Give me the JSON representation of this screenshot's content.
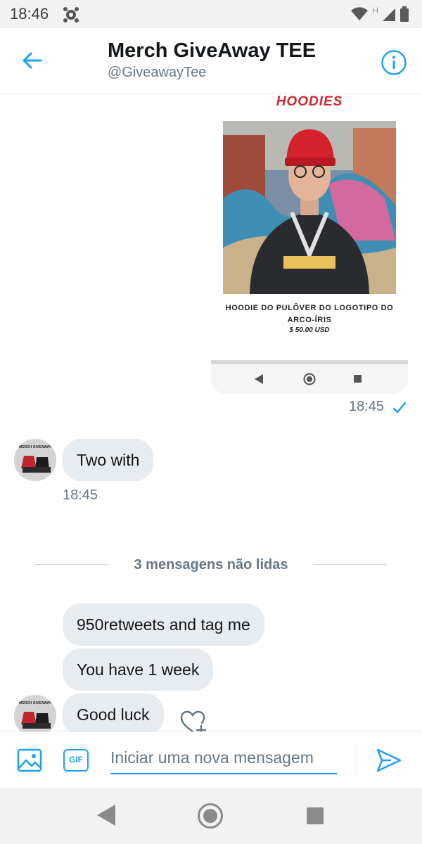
{
  "status_bar": {
    "time": "18:46",
    "network_label": "H"
  },
  "header": {
    "title": "Merch GiveAway TEE",
    "handle": "@GiveawayTee"
  },
  "image_message": {
    "promo_title": "HOODIES",
    "product_name": "HOODIE DO PULÔVER DO LOGOTIPO DO ARCO-ÍRIS",
    "price": "$ 50.00 USD",
    "timestamp": "18:45"
  },
  "received_1": {
    "text": "Two with",
    "timestamp": "18:45"
  },
  "avatar_caption": "MERCH GIVEAWAY",
  "unread_divider": "3 mensagens não lidas",
  "received_group": [
    {
      "text": "950retweets and tag me"
    },
    {
      "text": "You have 1 week"
    },
    {
      "text": "Good luck"
    }
  ],
  "composer": {
    "placeholder": "Iniciar uma nova mensagem",
    "gif_label": "GIF"
  },
  "colors": {
    "accent": "#1da1f2",
    "bubble": "#e6ecf0",
    "secondary_text": "#657786"
  }
}
